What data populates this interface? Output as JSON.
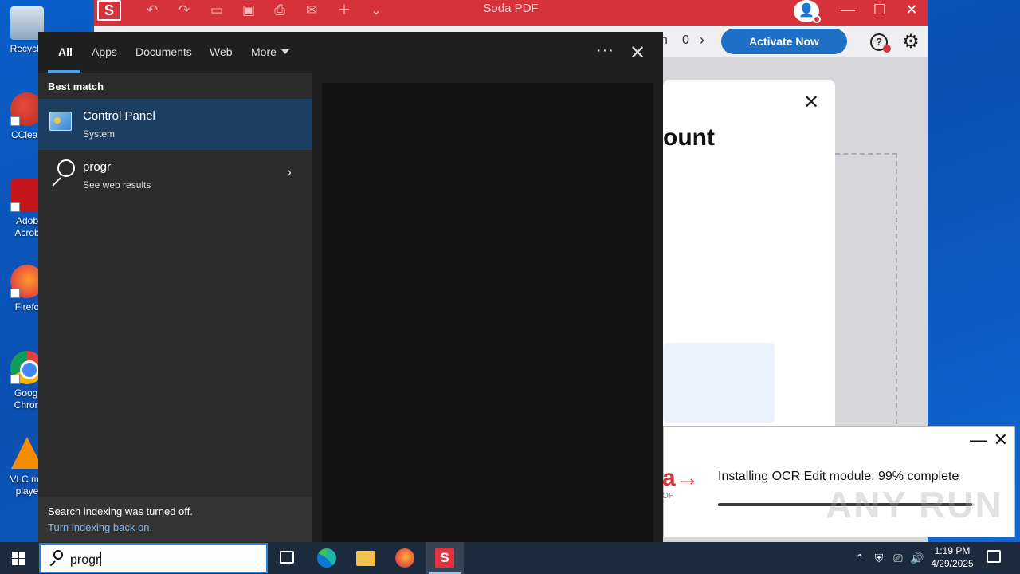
{
  "desktop": {
    "icons": [
      {
        "label": "Recycle",
        "icon": "recycle-bin-icon"
      },
      {
        "label": "CClean",
        "icon": "ccleaner-icon"
      },
      {
        "label": "Adob",
        "label2": "Acrob",
        "icon": "acrobat-icon"
      },
      {
        "label": "Firefo",
        "icon": "firefox-icon"
      },
      {
        "label": "Googl",
        "label2": "Chron",
        "icon": "chrome-icon"
      },
      {
        "label": "VLC me",
        "label2": "playe",
        "icon": "vlc-icon"
      }
    ]
  },
  "soda": {
    "title": "Soda PDF",
    "logo_letter": "S",
    "toolbar_fragment_1": "n",
    "toolbar_fragment_2": "0",
    "activate_label": "Activate Now",
    "help_symbol": "?",
    "dialog_heading_fragment": "ount",
    "brand_color": "#d6323c",
    "accent_color": "#1e6fc6"
  },
  "ocr_toast": {
    "status": "Installing OCR Edit module: 99% complete",
    "progress": 0.99,
    "logo_fragment": "a→",
    "logo_sub_fragment": "OP"
  },
  "watermark": "ANY RUN",
  "search_panel": {
    "tabs": [
      {
        "label": "All",
        "active": true
      },
      {
        "label": "Apps"
      },
      {
        "label": "Documents"
      },
      {
        "label": "Web"
      },
      {
        "label": "More"
      }
    ],
    "more_dots": "···",
    "best_match_label": "Best match",
    "results": [
      {
        "title": "Control Panel",
        "subtitle": "System",
        "icon": "control-panel-icon",
        "selected": true
      },
      {
        "title": "progr",
        "subtitle": "See web results",
        "icon": "search-icon"
      }
    ],
    "index_note": {
      "line1": "Search indexing was turned off.",
      "line2": "Turn indexing back on."
    }
  },
  "taskbar": {
    "search_query": "progr",
    "apps": [
      "task-view-icon",
      "edge-icon",
      "file-explorer-icon",
      "firefox-icon",
      "soda-pdf-icon"
    ],
    "soda_letter": "S",
    "clock": {
      "time": "1:19 PM",
      "date": "4/29/2025"
    },
    "accent_color": "#2b7fd8"
  }
}
